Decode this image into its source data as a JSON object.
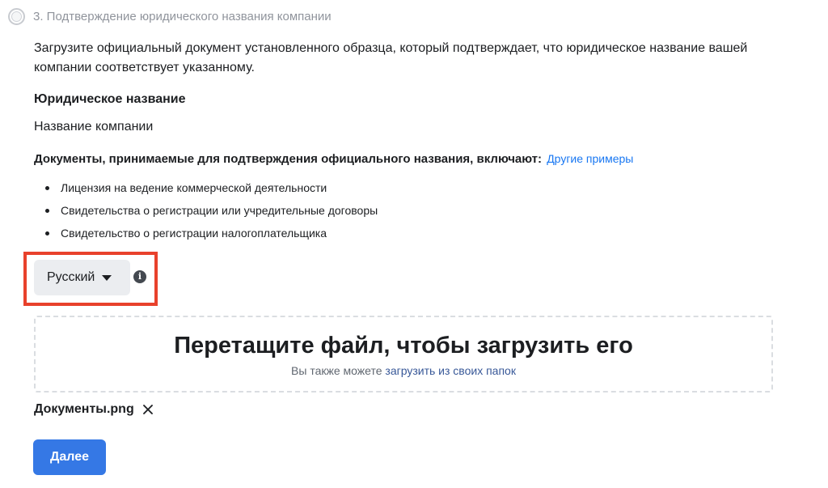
{
  "step": {
    "title": "3. Подтверждение юридического названия компании"
  },
  "description": "Загрузите официальный документ установленного образца, который подтверждает, что юридическое название вашей компании соответствует указанному.",
  "legal_name": {
    "label": "Юридическое название",
    "value": "Название компании"
  },
  "documents": {
    "heading": "Документы, принимаемые для подтверждения официального названия, включают:",
    "link": "Другие примеры",
    "items": [
      "Лицензия на ведение коммерческой деятельности",
      "Свидетельства о регистрации или учредительные договоры",
      "Свидетельство о регистрации налогоплательщика"
    ]
  },
  "language_select": {
    "value": "Русский"
  },
  "dropzone": {
    "title": "Перетащите файл, чтобы загрузить его",
    "sub_text": "Вы также можете",
    "sub_link": "загрузить из своих папок"
  },
  "file": {
    "name": "Документы.png"
  },
  "next_button": {
    "label": "Далее"
  },
  "colors": {
    "accent": "#3578e5",
    "link": "#1877f2",
    "highlight": "#e8412c"
  }
}
